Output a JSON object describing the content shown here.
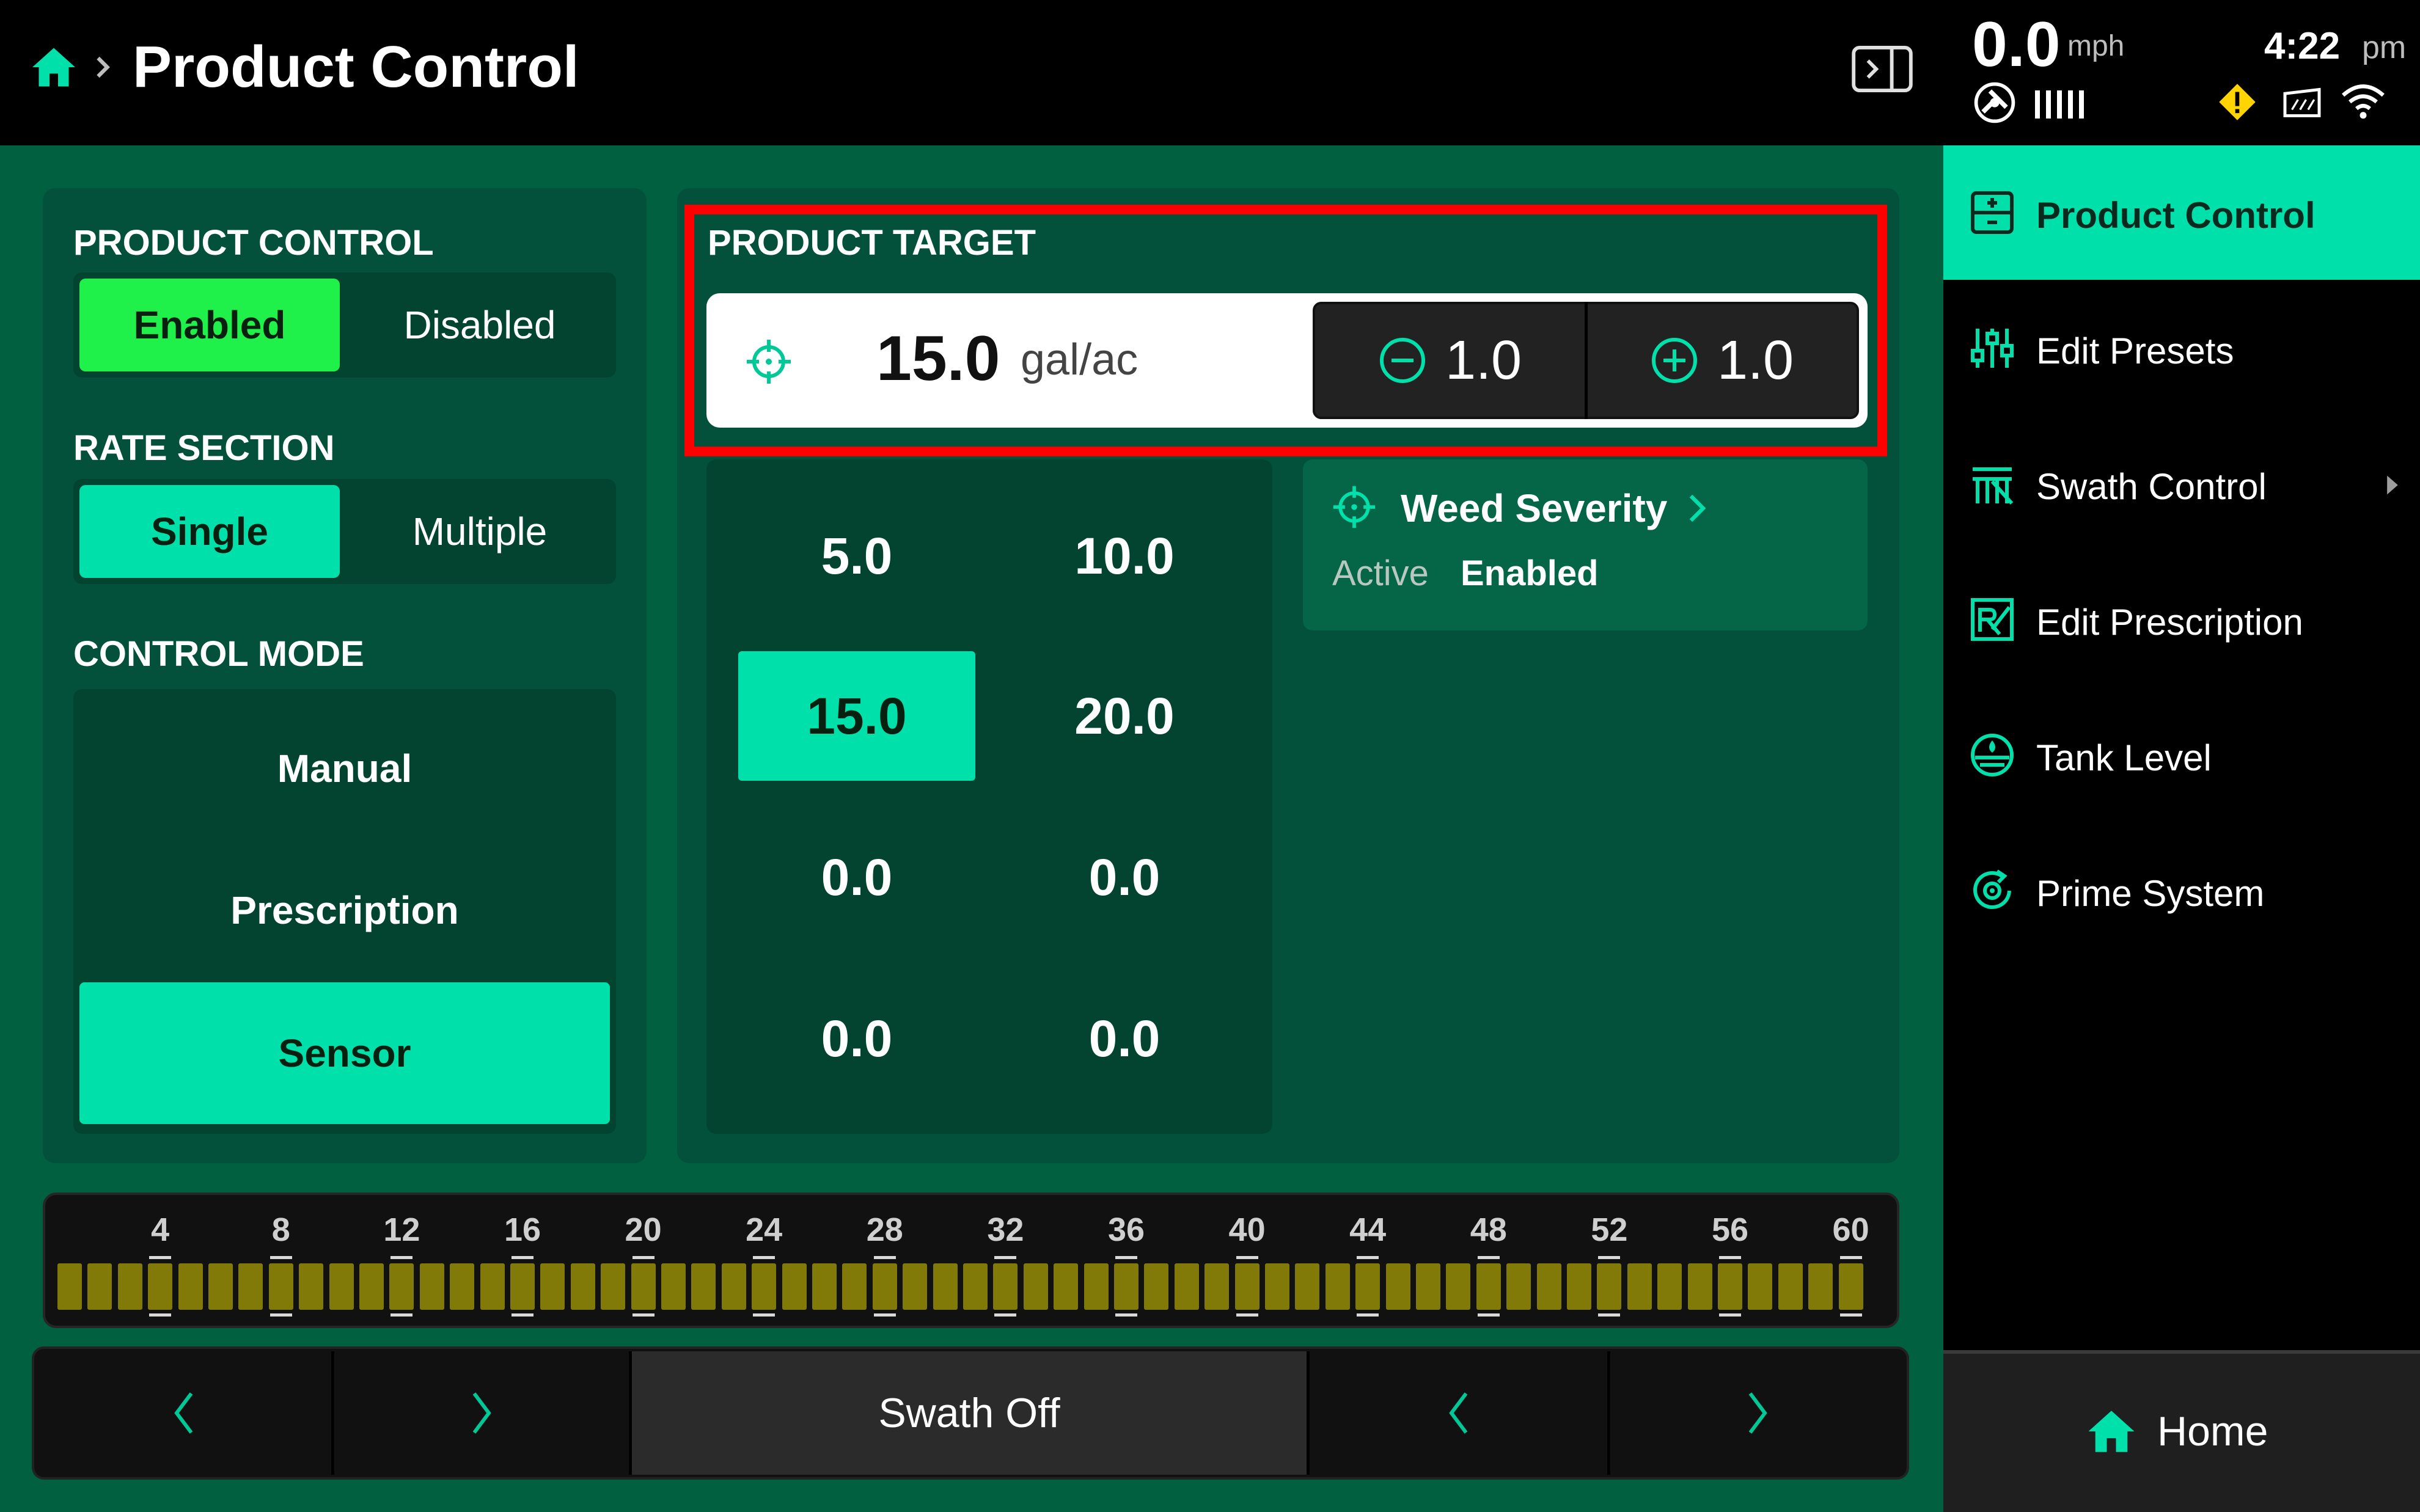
{
  "header": {
    "title": "Product Control",
    "speed": "0.0",
    "speed_unit": "mph",
    "time": "4:22",
    "ampm": "pm"
  },
  "left": {
    "product_control_label": "PRODUCT CONTROL",
    "enabled": "Enabled",
    "disabled": "Disabled",
    "rate_section_label": "RATE SECTION",
    "single": "Single",
    "multiple": "Multiple",
    "control_mode_label": "CONTROL MODE",
    "modes": [
      "Manual",
      "Prescription",
      "Sensor"
    ],
    "active_mode": "Sensor"
  },
  "target": {
    "label": "PRODUCT TARGET",
    "value": "15.0",
    "unit": "gal/ac",
    "decrement": "1.0",
    "increment": "1.0"
  },
  "presets": [
    "5.0",
    "10.0",
    "15.0",
    "20.0",
    "0.0",
    "0.0",
    "0.0",
    "0.0"
  ],
  "active_preset_index": 2,
  "weed": {
    "title": "Weed Severity",
    "status_label": "Active",
    "status_value": "Enabled"
  },
  "section_bar": {
    "ticks": [
      "4",
      "8",
      "12",
      "16",
      "20",
      "24",
      "28",
      "32",
      "36",
      "40",
      "44",
      "48",
      "52",
      "56",
      "60"
    ],
    "section_count": 60
  },
  "swath": {
    "label": "Swath Off"
  },
  "nav": {
    "items": [
      "Product Control",
      "Edit Presets",
      "Swath Control",
      "Edit Prescription",
      "Tank Level",
      "Prime System"
    ],
    "home": "Home"
  },
  "colors": {
    "accent": "#00e0aa",
    "enabled_green": "#1ff04a",
    "background": "#00603f",
    "section_color": "#827a08",
    "highlight": "#ff0000"
  }
}
